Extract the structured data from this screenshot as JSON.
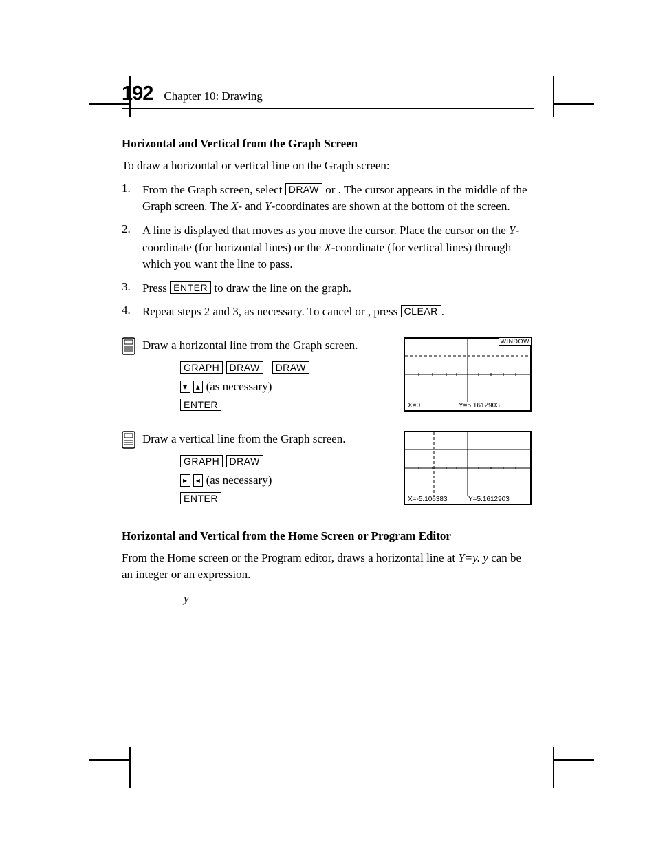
{
  "page_number": "192",
  "chapter_line": "Chapter 10: Drawing",
  "section1_title": "Horizontal and Vertical from the Graph Screen",
  "intro_text": "To draw a horizontal or vertical line on the Graph screen:",
  "step1_pre": "From the Graph screen, select ",
  "step1_key1": "DRAW",
  "step1_mid": " or ",
  "step1_post": ". The cursor appears in the middle of the Graph screen. The ",
  "step1_x": "X",
  "step1_afterx": "- and ",
  "step1_y": "Y",
  "step1_end": "-coordinates are shown at the bottom of the screen.",
  "step2_text1": "A line is displayed that moves as you move the cursor. Place the cursor on the ",
  "step2_y": "Y",
  "step2_text2": "-coordinate (for horizontal lines) or the ",
  "step2_x": "X",
  "step2_text3": "-coordinate (for vertical lines) through which you want the line to pass.",
  "step3_press": "Press ",
  "step3_enter": "ENTER",
  "step3_rest": " to draw the line on the graph.",
  "step4_text1": "Repeat steps 2 and 3, as necessary. To cancel ",
  "step4_or": " or ",
  "step4_press": ", press ",
  "step4_clear": "CLEAR",
  "step4_end": ".",
  "ex1_text": "Draw a horizontal line from the Graph screen.",
  "ex2_text": "Draw a vertical line from the Graph screen.",
  "key_graph": "GRAPH",
  "key_draw": "DRAW",
  "key_enter": "ENTER",
  "as_necessary": " (as necessary)",
  "window_label": "WINDOW",
  "screen1_x": "X=0",
  "screen1_y": "Y=5.1612903",
  "screen2_x": "X=-5.106383",
  "screen2_y": "Y=5.1612903",
  "section2_title": "Horizontal and Vertical from the Home Screen or Program Editor",
  "sec2_p1": "From the Home screen or the Program editor, ",
  "sec2_p2": " draws a horizontal line at ",
  "sec2_yeqy": "Y=y. y",
  "sec2_p3": " can be an integer or an expression.",
  "sec2_yline": "y"
}
